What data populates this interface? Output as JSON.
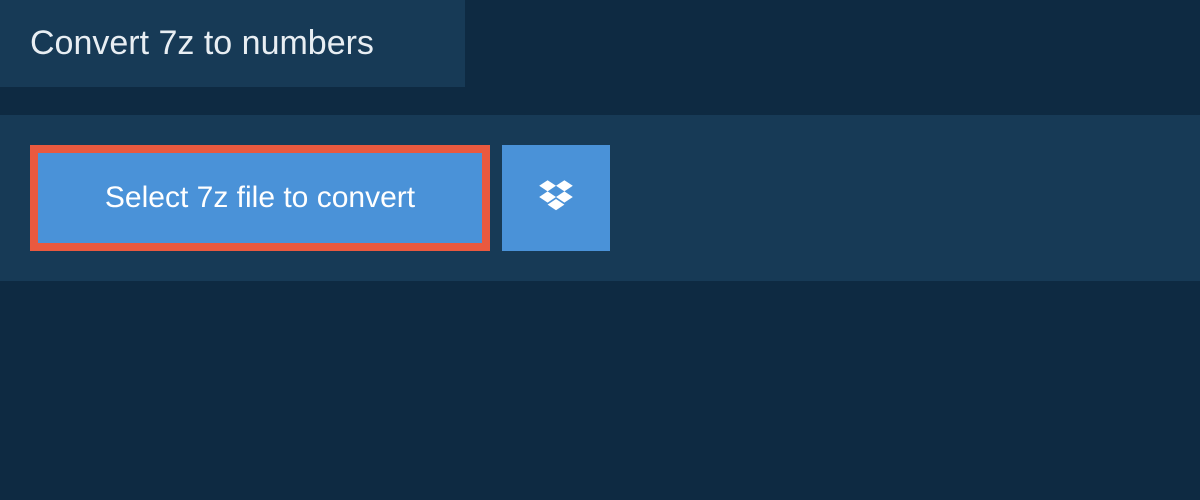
{
  "header": {
    "title": "Convert 7z to numbers"
  },
  "actions": {
    "select_label": "Select 7z file to convert"
  },
  "colors": {
    "accent_button": "#4a92d8",
    "highlight_border": "#e9593f",
    "panel_bg": "#173a56",
    "page_bg": "#0e2a42"
  }
}
